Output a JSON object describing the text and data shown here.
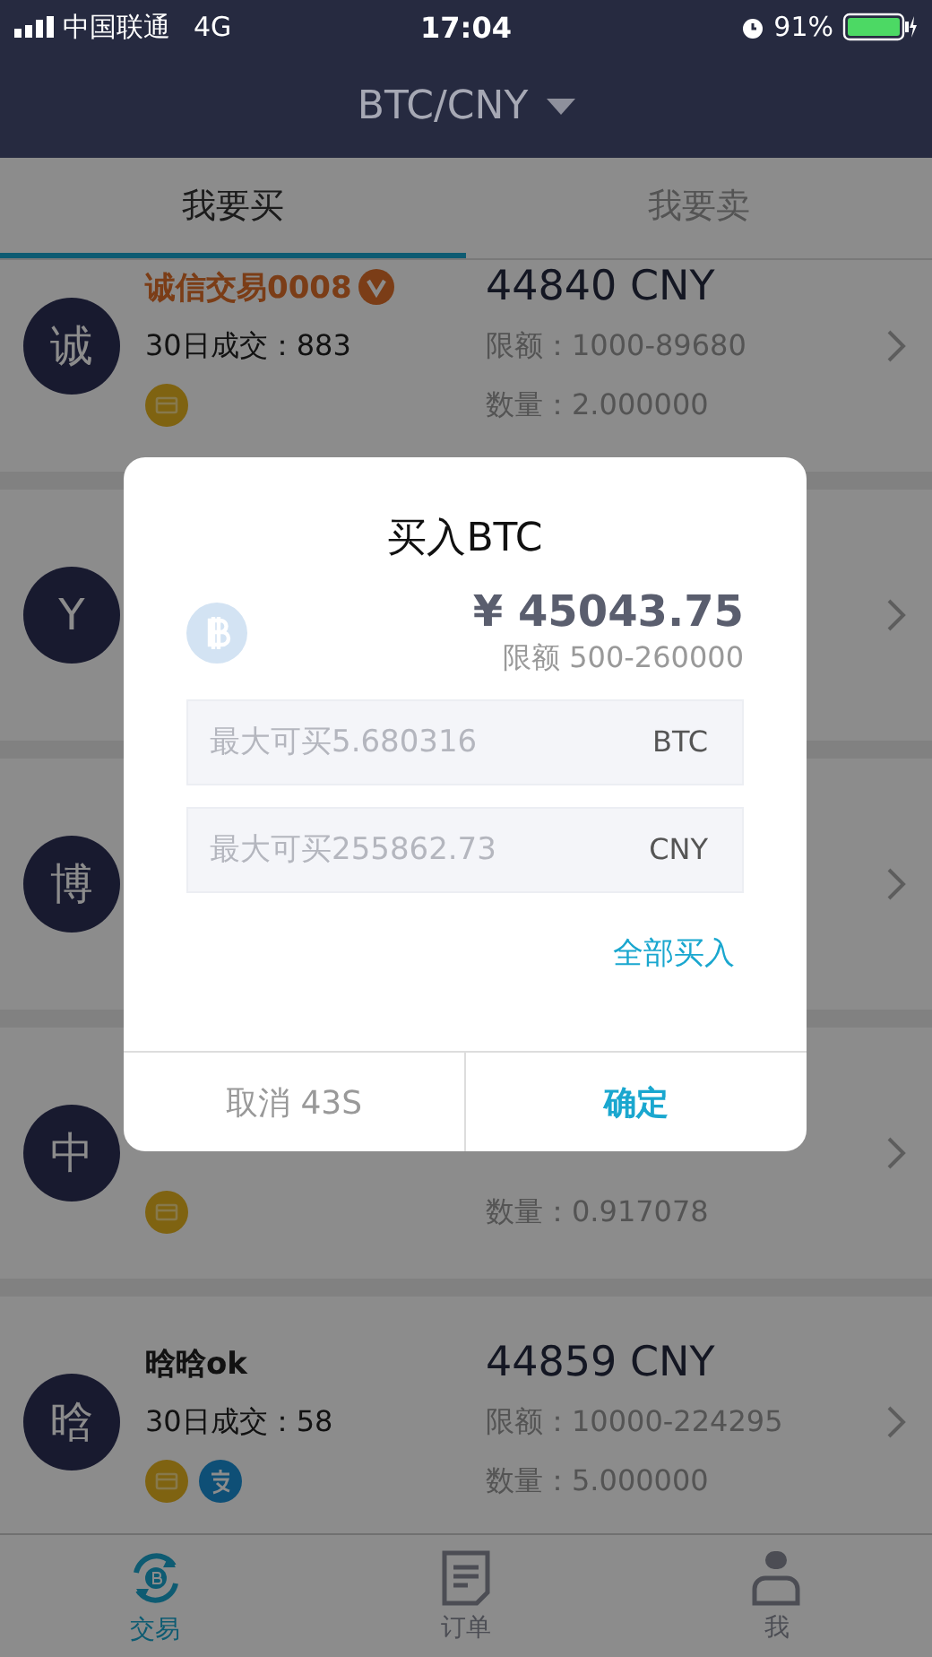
{
  "status_bar": {
    "carrier": "中国联通",
    "network": "4G",
    "time": "17:04",
    "battery": "91%"
  },
  "header": {
    "title": "BTC/CNY"
  },
  "tabs": [
    {
      "label": "我要买",
      "selected": true
    },
    {
      "label": "我要卖",
      "selected": false
    }
  ],
  "listings": [
    {
      "avatar": "诚",
      "name": "诚信交易0008",
      "verified": true,
      "trades": "30日成交：883",
      "payments": [
        {
          "kind": "bank"
        }
      ],
      "price": "44840 CNY",
      "limit": "限额：1000-89680",
      "amount": "数量：2.000000"
    },
    {
      "avatar": "Y"
    },
    {
      "avatar": "博"
    },
    {
      "avatar": "中",
      "payments": [
        {
          "kind": "bank"
        }
      ],
      "amount": "数量：0.917078"
    },
    {
      "avatar": "晗",
      "name": "晗晗ok",
      "verified": false,
      "trades": "30日成交：58",
      "payments": [
        {
          "kind": "bank"
        },
        {
          "kind": "alipay"
        }
      ],
      "price": "44859 CNY",
      "limit": "限额：10000-224295",
      "amount": "数量：5.000000"
    }
  ],
  "dialog": {
    "title": "买入BTC",
    "price": "¥ 45043.75",
    "limit": "限额 500-260000",
    "fields": [
      {
        "placeholder": "最大可买5.680316",
        "unit": "BTC"
      },
      {
        "placeholder": "最大可买255862.73",
        "unit": "CNY"
      }
    ],
    "buy_all": "全部买入",
    "cancel": "取消 43S",
    "confirm": "确定"
  },
  "tab_bar": [
    {
      "kind": "trade",
      "label": "交易",
      "selected": true
    },
    {
      "kind": "orders",
      "label": "订单",
      "selected": false
    },
    {
      "kind": "me",
      "label": "我",
      "selected": false
    }
  ]
}
